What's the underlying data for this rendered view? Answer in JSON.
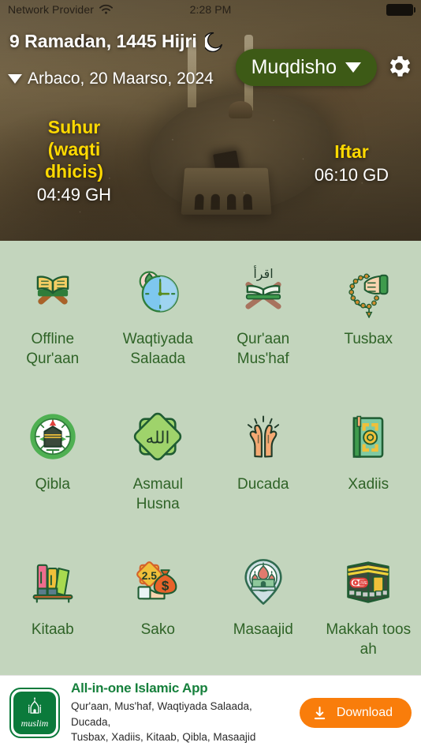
{
  "status_bar": {
    "carrier": "Network Provider",
    "wifi_icon": "wifi-icon",
    "time": "2:28 PM",
    "battery_icon": "battery-icon"
  },
  "header": {
    "hijri_date": "9 Ramadan, 1445 Hijri",
    "moon_icon": "crescent-moon-icon",
    "gregorian_caret_icon": "caret-down-icon",
    "gregorian_date": "Arbaco, 20 Maarso, 2024",
    "city_label": "Muqdisho",
    "city_caret_icon": "caret-down-icon",
    "settings_icon": "gear-icon",
    "pill_color": "#3d5a16",
    "accent_yellow": "#ffd900"
  },
  "prayer_times": {
    "suhur": {
      "label": "Suhur (waqti dhicis)",
      "label_line1": "Suhur",
      "label_line2": "(waqti",
      "label_line3": "dhicis)",
      "time": "04:49 GH"
    },
    "iftar": {
      "label": "Iftar",
      "time": "06:10 GD"
    }
  },
  "grid": {
    "label_color": "#2f6327",
    "background": "#c3d5bd",
    "rows": [
      [
        {
          "label": "Offline Qur'aan",
          "icon": "open-quran-book-icon"
        },
        {
          "label": "Waqtiyada Salaada",
          "icon": "prayer-clock-icon"
        },
        {
          "label": "Qur'aan Mus'haf",
          "icon": "quran-on-rehal-icon"
        },
        {
          "label": "Tusbax",
          "icon": "prayer-beads-hand-icon"
        }
      ],
      [
        {
          "label": "Qibla",
          "icon": "qibla-compass-icon"
        },
        {
          "label": "Asmaul Husna",
          "icon": "allah-star-icon"
        },
        {
          "label": "Ducada",
          "icon": "praying-hands-icon"
        },
        {
          "label": "Xadiis",
          "icon": "hadith-book-icon"
        }
      ],
      [
        {
          "label": "Kitaab",
          "icon": "bookshelf-icon"
        },
        {
          "label": "Sako",
          "icon": "zakat-money-bag-icon"
        },
        {
          "label": "Masaajid",
          "icon": "mosque-map-pin-icon"
        },
        {
          "label": "Makkah toos ah",
          "icon": "kaaba-live-icon"
        }
      ]
    ]
  },
  "ad_banner": {
    "logo_icon": "muslim-app-logo-icon",
    "logo_text": "muslim",
    "title": "All-in-one Islamic App",
    "description_line1": "Qur'aan, Mus'haf, Waqtiyada Salaada, Ducada,",
    "description_line2": "Tusbax, Xadiis, Kitaab, Qibla, Masaajid",
    "download_label": "Download",
    "download_icon": "download-arrow-icon",
    "download_color": "#f97d0b",
    "title_color": "#16803c"
  }
}
